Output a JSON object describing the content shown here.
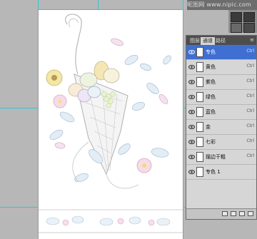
{
  "watermark": "昵图网 www.nipic.com",
  "panel": {
    "tabs": [
      "图层",
      "通道",
      "路径"
    ],
    "menu_label": "≡",
    "rows": [
      {
        "label": "专色",
        "shortcut": "Ctrl",
        "selected": true
      },
      {
        "label": "黄色",
        "shortcut": "Ctrl"
      },
      {
        "label": "紫色",
        "shortcut": "Ctrl"
      },
      {
        "label": "绿色",
        "shortcut": "Ctrl"
      },
      {
        "label": "蓝色",
        "shortcut": "Ctrl"
      },
      {
        "label": "金",
        "shortcut": "Ctrl"
      },
      {
        "label": "七彩",
        "shortcut": "Ctrl"
      },
      {
        "label": "描边干粗",
        "shortcut": "Ctrl"
      },
      {
        "label": "专色 1",
        "shortcut": ""
      }
    ]
  },
  "colors": {
    "guide": "#35c6d6",
    "selected_row": "#3f6fd0",
    "workspace": "#b7b7b7"
  }
}
